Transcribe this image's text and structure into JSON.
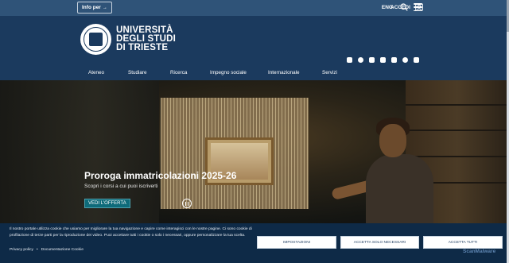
{
  "topbar": {
    "info_label": "Info per",
    "lang": "ENG",
    "login": "ACCEDI"
  },
  "header": {
    "logo_line1": "UNIVERSITÀ",
    "logo_line2": "DEGLI STUDI",
    "logo_line3": "DI TRIESTE",
    "social": [
      "instagram-icon",
      "facebook-icon",
      "linkedin-icon",
      "youtube-icon",
      "x-icon",
      "threads-icon",
      "rss-icon"
    ]
  },
  "nav": {
    "items": [
      "Ateneo",
      "Studiare",
      "Ricerca",
      "Impegno sociale",
      "Internazionale",
      "Servizi"
    ]
  },
  "hero": {
    "title": "Proroga immatricolazioni 2025-26",
    "subtitle": "Scopri i corsi a cui puoi iscriverti",
    "cta": "VEDI L'OFFERTA"
  },
  "cookie": {
    "text": "Il nostro portale utilizza cookie che usiamo per migliorare la tua navigazione e capire come interagisci con le nostre pagine. Ci sono cookie di profilazione di terze parti per la riproduzione dei video. Puoi accettare tutti i cookie o solo i necessari, oppure personalizzare la tua scelta.",
    "privacy": "Privacy policy",
    "docs": "Documentazione Cookie",
    "settings": "IMPOSTAZIONI",
    "accept_necessary": "ACCETTA SOLO NECESSARI",
    "accept_all": "ACCETTA TUTTI"
  },
  "watermark": "ScanMalware",
  "colors": {
    "header_bg": "#1b3a5e",
    "topbar_bg": "#2f5378",
    "cookie_bg": "#0e2a47",
    "cta_bg": "#0e6b7a"
  }
}
